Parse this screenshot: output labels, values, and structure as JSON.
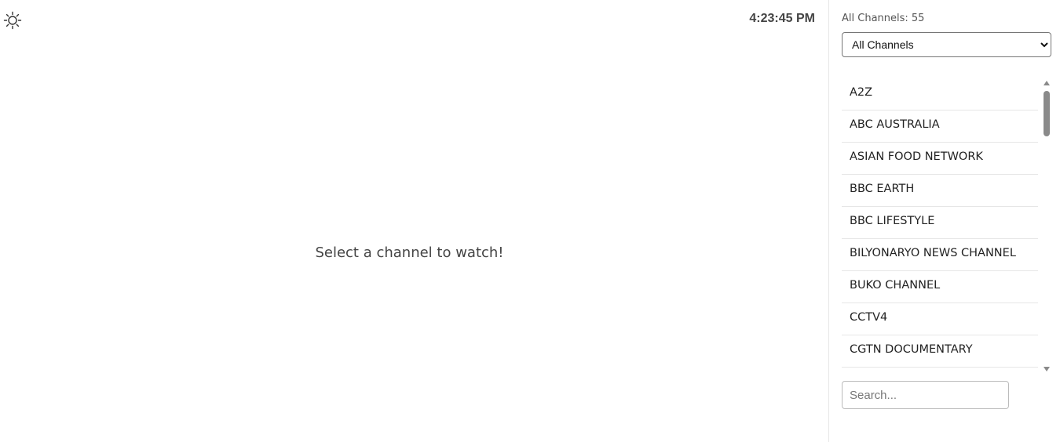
{
  "header": {
    "clock": "4:23:45 PM",
    "theme_icon": "sun-icon"
  },
  "main": {
    "placeholder_text": "Select a channel to watch!"
  },
  "sidebar": {
    "count_label": "All Channels: 55",
    "filter": {
      "selected": "All Channels",
      "options": [
        "All Channels"
      ]
    },
    "channels": [
      "A2Z",
      "ABC AUSTRALIA",
      "ASIAN FOOD NETWORK",
      "BBC EARTH",
      "BBC LIFESTYLE",
      "BILYONARYO NEWS CHANNEL",
      "BUKO CHANNEL",
      "CCTV4",
      "CGTN DOCUMENTARY"
    ],
    "search": {
      "placeholder": "Search...",
      "value": ""
    }
  },
  "colors": {
    "text": "#222222",
    "divider": "#e6e6e6",
    "scrollbar": "#8a8a8a"
  }
}
